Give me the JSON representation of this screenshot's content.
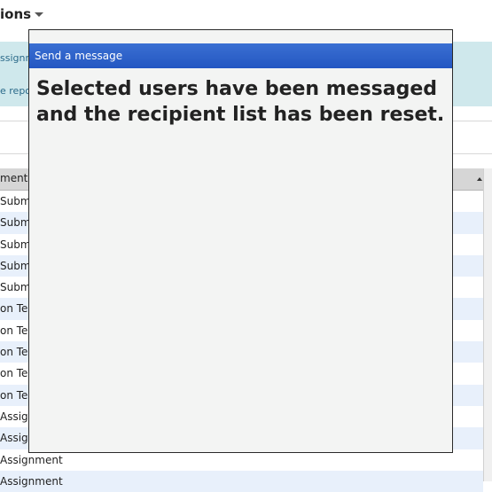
{
  "page": {
    "title_fragment": "ions"
  },
  "banner": {
    "line1": "ssignm",
    "line2": "e repor"
  },
  "table": {
    "header": "ment",
    "rows": [
      " Subm",
      " Subm",
      " Subm",
      " Subm",
      " Subm",
      "on Tes",
      "on Tes",
      "on Tes",
      "on Tes",
      "on Tes",
      "Assign",
      "Assign",
      "Assignment",
      "Assignment"
    ]
  },
  "modal": {
    "title": "Send a message",
    "message": "Selected users have been messaged and the recipient list has been reset."
  }
}
